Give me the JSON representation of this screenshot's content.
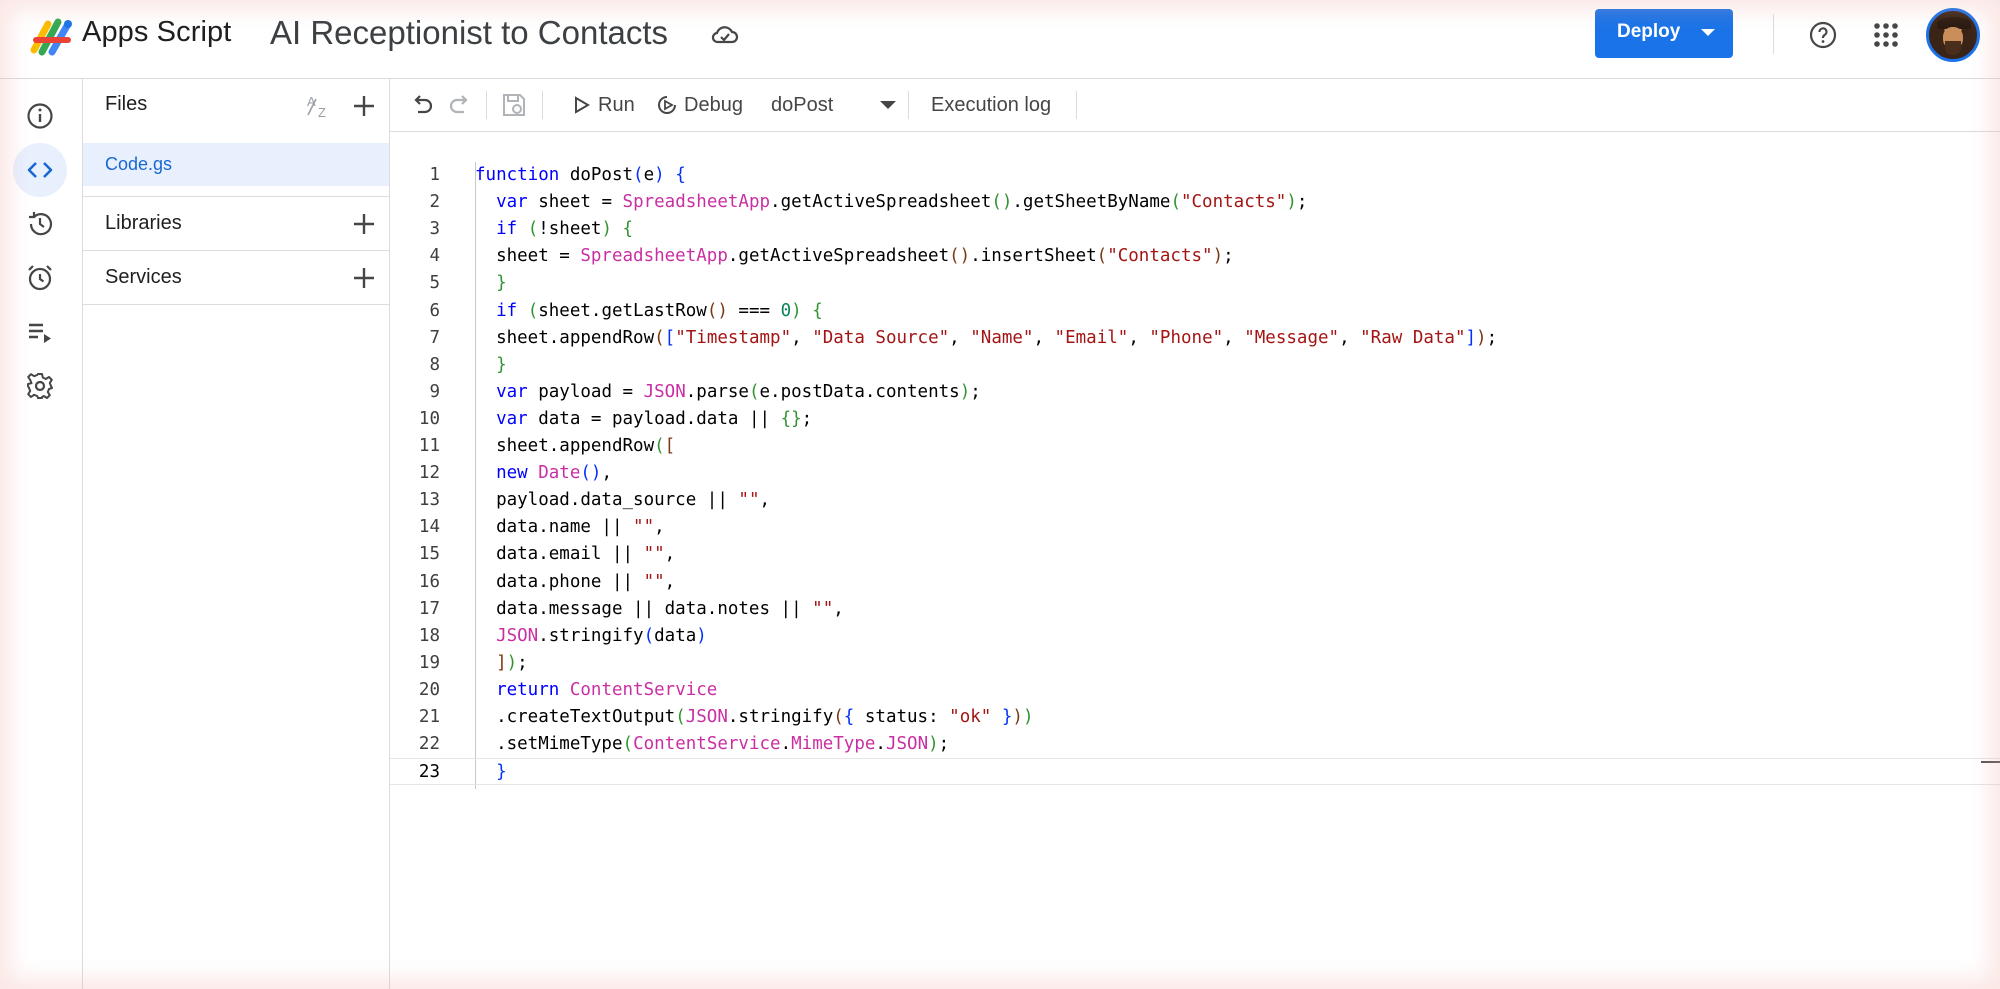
{
  "app": {
    "brand": "Apps Script",
    "project_title": "AI Receptionist to Contacts"
  },
  "header": {
    "deploy_label": "Deploy"
  },
  "files_panel": {
    "title": "Files",
    "files": [
      "Code.gs"
    ],
    "libraries_label": "Libraries",
    "services_label": "Services"
  },
  "toolbar": {
    "run_label": "Run",
    "debug_label": "Debug",
    "function_selected": "doPost",
    "execution_log_label": "Execution log"
  },
  "editor": {
    "current_line": 23,
    "lines": [
      [
        [
          "function ",
          "kw"
        ],
        [
          "doPost",
          ""
        ],
        [
          "(",
          "pb"
        ],
        [
          "e",
          ""
        ],
        [
          ")",
          "pb"
        ],
        [
          " ",
          ""
        ],
        [
          "{",
          "pb"
        ]
      ],
      [
        [
          "  ",
          ""
        ],
        [
          "var ",
          "kw"
        ],
        [
          "sheet = ",
          ""
        ],
        [
          "SpreadsheetApp",
          "cls"
        ],
        [
          ".getActiveSpreadsheet",
          ""
        ],
        [
          "()",
          "pg"
        ],
        [
          ".getSheetByName",
          ""
        ],
        [
          "(",
          "pg"
        ],
        [
          "\"Contacts\"",
          "str"
        ],
        [
          ")",
          "pg"
        ],
        [
          ";",
          ""
        ]
      ],
      [
        [
          "  ",
          ""
        ],
        [
          "if ",
          "kw"
        ],
        [
          "(",
          "pg"
        ],
        [
          "!sheet",
          ""
        ],
        [
          ")",
          "pg"
        ],
        [
          " ",
          ""
        ],
        [
          "{",
          "pg"
        ]
      ],
      [
        [
          "  sheet = ",
          ""
        ],
        [
          "SpreadsheetApp",
          "cls"
        ],
        [
          ".getActiveSpreadsheet",
          ""
        ],
        [
          "()",
          "pr"
        ],
        [
          ".insertSheet",
          ""
        ],
        [
          "(",
          "pr"
        ],
        [
          "\"Contacts\"",
          "str"
        ],
        [
          ")",
          "pr"
        ],
        [
          ";",
          ""
        ]
      ],
      [
        [
          "  ",
          ""
        ],
        [
          "}",
          "pg"
        ]
      ],
      [
        [
          "  ",
          ""
        ],
        [
          "if ",
          "kw"
        ],
        [
          "(",
          "pg"
        ],
        [
          "sheet.getLastRow",
          ""
        ],
        [
          "()",
          "pr"
        ],
        [
          " === ",
          ""
        ],
        [
          "0",
          "num"
        ],
        [
          ")",
          "pg"
        ],
        [
          " ",
          ""
        ],
        [
          "{",
          "pg"
        ]
      ],
      [
        [
          "  sheet.appendRow",
          ""
        ],
        [
          "(",
          "pr"
        ],
        [
          "[",
          "pb"
        ],
        [
          "\"Timestamp\"",
          "str"
        ],
        [
          ", ",
          ""
        ],
        [
          "\"Data Source\"",
          "str"
        ],
        [
          ", ",
          ""
        ],
        [
          "\"Name\"",
          "str"
        ],
        [
          ", ",
          ""
        ],
        [
          "\"Email\"",
          "str"
        ],
        [
          ", ",
          ""
        ],
        [
          "\"Phone\"",
          "str"
        ],
        [
          ", ",
          ""
        ],
        [
          "\"Message\"",
          "str"
        ],
        [
          ", ",
          ""
        ],
        [
          "\"Raw Data\"",
          "str"
        ],
        [
          "]",
          "pb"
        ],
        [
          ")",
          "pr"
        ],
        [
          ";",
          ""
        ]
      ],
      [
        [
          "  ",
          ""
        ],
        [
          "}",
          "pg"
        ]
      ],
      [
        [
          "  ",
          ""
        ],
        [
          "var ",
          "kw"
        ],
        [
          "payload = ",
          ""
        ],
        [
          "JSON",
          "cls"
        ],
        [
          ".parse",
          ""
        ],
        [
          "(",
          "pg"
        ],
        [
          "e.postData.contents",
          ""
        ],
        [
          ")",
          "pg"
        ],
        [
          ";",
          ""
        ]
      ],
      [
        [
          "  ",
          ""
        ],
        [
          "var ",
          "kw"
        ],
        [
          "data = payload.data || ",
          ""
        ],
        [
          "{}",
          "pg"
        ],
        [
          ";",
          ""
        ]
      ],
      [
        [
          "  sheet.appendRow",
          ""
        ],
        [
          "(",
          "pg"
        ],
        [
          "[",
          "pr"
        ]
      ],
      [
        [
          "  ",
          ""
        ],
        [
          "new ",
          "kw"
        ],
        [
          "Date",
          "cls"
        ],
        [
          "()",
          "pb"
        ],
        [
          ",",
          ""
        ]
      ],
      [
        [
          "  payload.data_source || ",
          ""
        ],
        [
          "\"\"",
          "str"
        ],
        [
          ",",
          ""
        ]
      ],
      [
        [
          "  data.name || ",
          ""
        ],
        [
          "\"\"",
          "str"
        ],
        [
          ",",
          ""
        ]
      ],
      [
        [
          "  data.email || ",
          ""
        ],
        [
          "\"\"",
          "str"
        ],
        [
          ",",
          ""
        ]
      ],
      [
        [
          "  data.phone || ",
          ""
        ],
        [
          "\"\"",
          "str"
        ],
        [
          ",",
          ""
        ]
      ],
      [
        [
          "  data.message || data.notes || ",
          ""
        ],
        [
          "\"\"",
          "str"
        ],
        [
          ",",
          ""
        ]
      ],
      [
        [
          "  ",
          ""
        ],
        [
          "JSON",
          "cls"
        ],
        [
          ".stringify",
          ""
        ],
        [
          "(",
          "pb"
        ],
        [
          "data",
          ""
        ],
        [
          ")",
          "pb"
        ]
      ],
      [
        [
          "  ",
          ""
        ],
        [
          "]",
          "pr"
        ],
        [
          ")",
          "pg"
        ],
        [
          ";",
          ""
        ]
      ],
      [
        [
          "  ",
          ""
        ],
        [
          "return ",
          "kw"
        ],
        [
          "ContentService",
          "cls"
        ]
      ],
      [
        [
          "  .createTextOutput",
          ""
        ],
        [
          "(",
          "pg"
        ],
        [
          "JSON",
          "cls"
        ],
        [
          ".stringify",
          ""
        ],
        [
          "(",
          "pr"
        ],
        [
          "{",
          "pb"
        ],
        [
          " status: ",
          ""
        ],
        [
          "\"ok\"",
          "str"
        ],
        [
          " ",
          ""
        ],
        [
          "}",
          "pb"
        ],
        [
          ")",
          "pr"
        ],
        [
          ")",
          "pg"
        ]
      ],
      [
        [
          "  .setMimeType",
          ""
        ],
        [
          "(",
          "pg"
        ],
        [
          "ContentService",
          "cls"
        ],
        [
          ".",
          ""
        ],
        [
          "MimeType",
          "cls"
        ],
        [
          ".",
          ""
        ],
        [
          "JSON",
          "cls"
        ],
        [
          ")",
          "pg"
        ],
        [
          ";",
          ""
        ]
      ],
      [
        [
          "  ",
          ""
        ],
        [
          "}",
          "pb"
        ]
      ]
    ]
  },
  "colors": {
    "accent": "#1a73e8",
    "selected_bg": "#e8f0fe",
    "keyword": "#0000ff",
    "class_name": "#c92fa3",
    "string": "#a31515",
    "number": "#098658"
  }
}
